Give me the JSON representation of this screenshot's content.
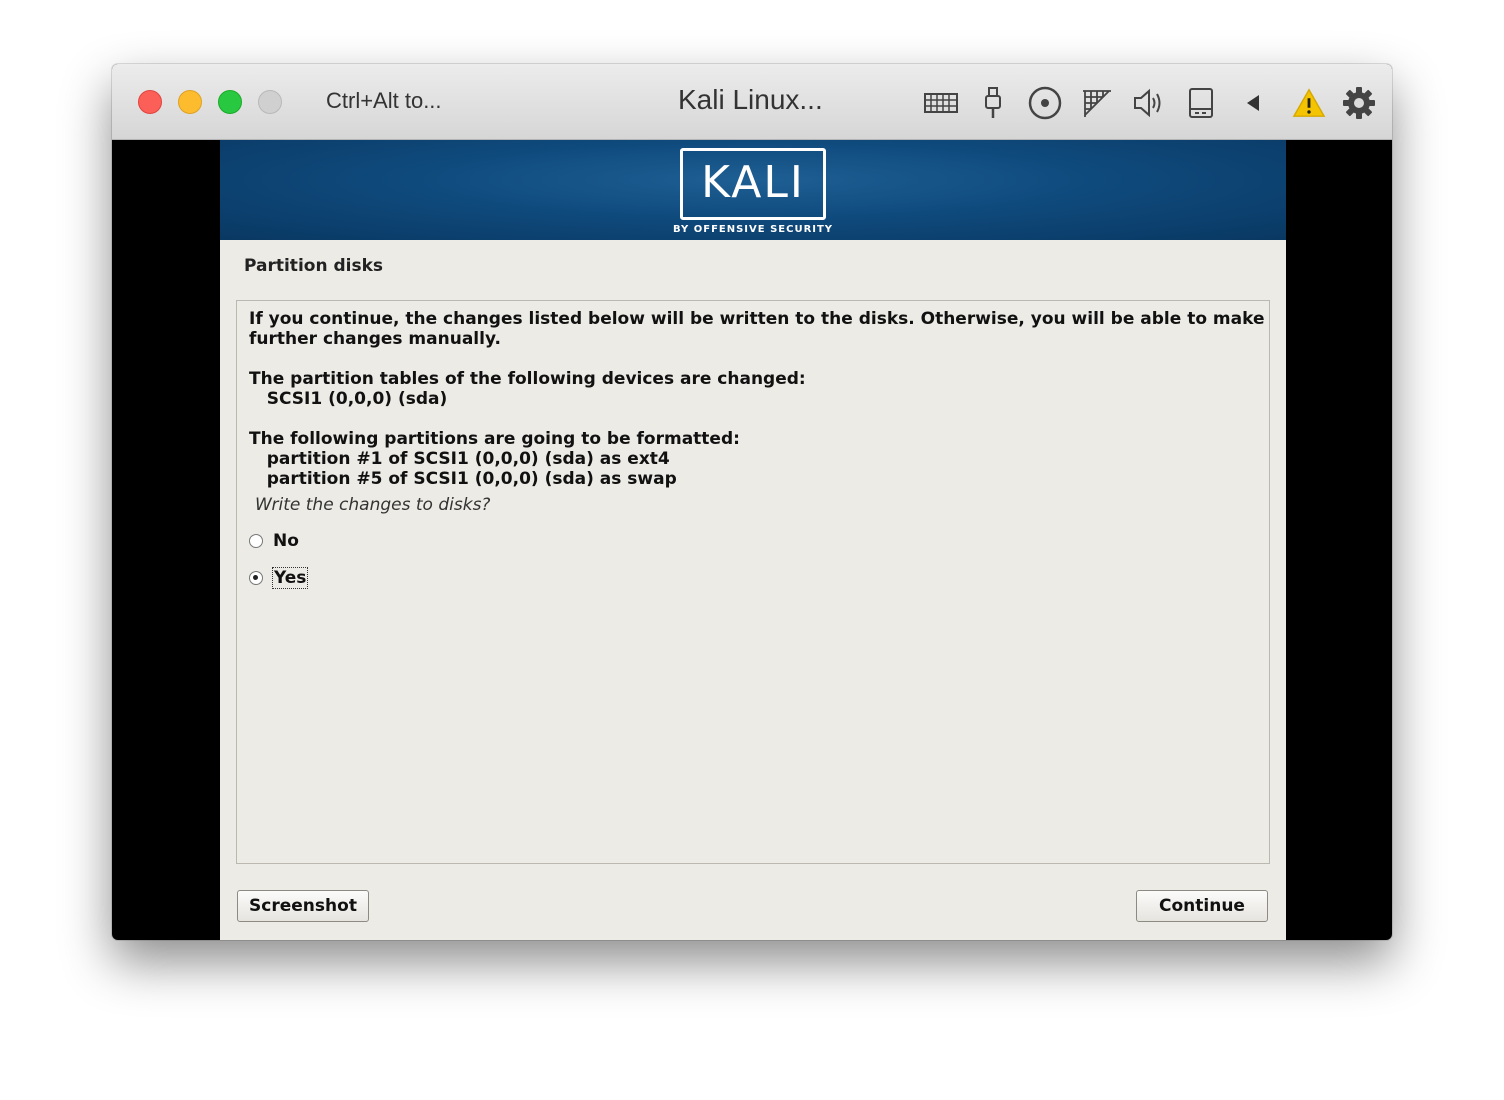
{
  "window": {
    "hint": "Ctrl+Alt to...",
    "title": "Kali Linux..."
  },
  "toolbar_icons": [
    "keyboard-icon",
    "usb-icon",
    "optical-disc-icon",
    "network-icon",
    "audio-icon",
    "hard-disk-icon",
    "collapse-arrow-icon",
    "warning-icon",
    "settings-gear-icon"
  ],
  "banner": {
    "logo": "KALI",
    "tagline": "BY OFFENSIVE SECURITY"
  },
  "installer": {
    "page_title": "Partition disks",
    "message_lines": [
      "If you continue, the changes listed below will be written to the disks. Otherwise, you will be able to make",
      "further changes manually.",
      "",
      "The partition tables of the following devices are changed:",
      "   SCSI1 (0,0,0) (sda)",
      "",
      "The following partitions are going to be formatted:",
      "   partition #1 of SCSI1 (0,0,0) (sda) as ext4",
      "   partition #5 of SCSI1 (0,0,0) (sda) as swap"
    ],
    "question": "Write the changes to disks?",
    "options": [
      {
        "label": "No",
        "selected": false
      },
      {
        "label": "Yes",
        "selected": true
      }
    ],
    "screenshot_button": "Screenshot",
    "continue_button": "Continue"
  }
}
